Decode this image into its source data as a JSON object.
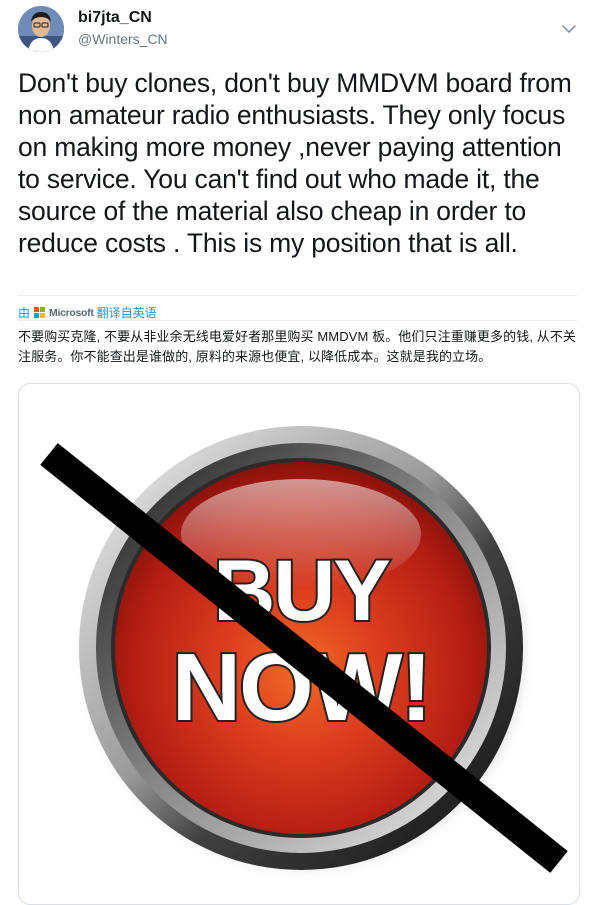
{
  "tweet": {
    "display_name": "bi7jta_CN",
    "handle": "@Winters_CN",
    "text": "Don't buy clones, don't buy MMDVM board from non amateur radio enthusiasts. They only focus on making more money ,never paying attention to service. You can't find out who made it, the source of the material also cheap in order to reduce costs . This is my position that is all.",
    "translation": {
      "prefix": "由",
      "provider": "Microsoft",
      "suffix": "翻译自英语",
      "text": "不要购买克隆, 不要从非业余无线电爱好者那里购买 MMDVM 板。他们只注重赚更多的钱, 从不关注服务。你不能查出是谁做的, 原料的来源也便宜, 以降低成本。这就是我的立场。"
    }
  },
  "media": {
    "button_text_line1": "BUY",
    "button_text_line2": "NOW!",
    "icon": "crossed-out-buy-now-button"
  },
  "icons": {
    "menu": "chevron-down-icon",
    "provider_logo": "microsoft-logo-icon"
  },
  "colors": {
    "text": "#14171a",
    "secondary": "#657786",
    "link": "#1b95e0",
    "button_red": "#c7261a"
  }
}
